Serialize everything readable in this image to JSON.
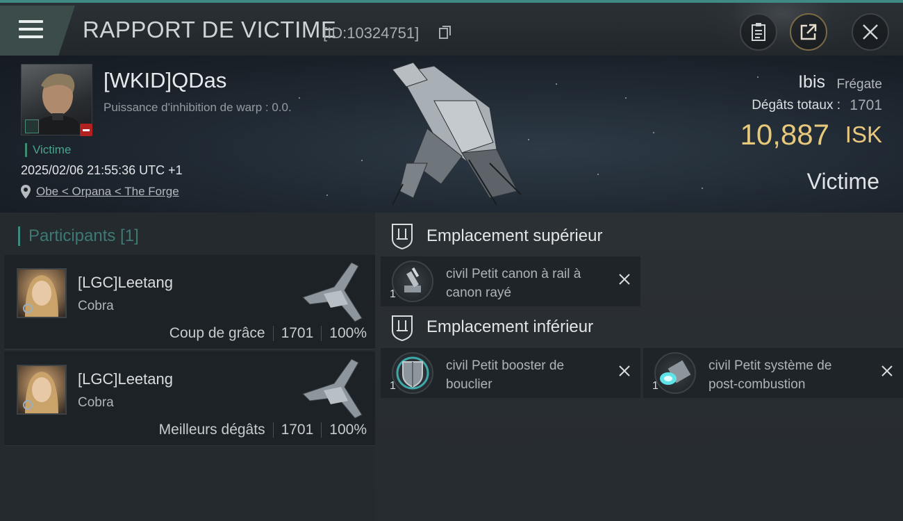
{
  "header": {
    "title": "RAPPORT DE VICTIME",
    "report_id": "[ID:10324751]"
  },
  "victim": {
    "name": "[WKID]QDas",
    "warp_text": "Puissance d'inhibition de warp : 0.0.",
    "tag": "Victime",
    "datetime": "2025/02/06 21:55:36 UTC +1",
    "location": "Obe < Orpana < The Forge",
    "ship_name": "Ibis",
    "ship_class": "Frégate",
    "damage_label": "Dégâts totaux :",
    "damage_value": "1701",
    "isk_value": "10,887",
    "isk_unit": "ISK",
    "role_label": "Victime"
  },
  "participants": {
    "header": "Participants [1]",
    "rows": [
      {
        "name": "[LGC]Leetang",
        "ship": "Cobra",
        "label": "Coup de grâce",
        "damage": "1701",
        "percent": "100%"
      },
      {
        "name": "[LGC]Leetang",
        "ship": "Cobra",
        "label": "Meilleurs dégâts",
        "damage": "1701",
        "percent": "100%"
      }
    ]
  },
  "slots": {
    "upper_title": "Emplacement supérieur",
    "lower_title": "Emplacement inférieur",
    "upper_modules": [
      {
        "name": "civil Petit canon à rail à canon rayé",
        "qty": "1",
        "icon": "railgun-icon"
      }
    ],
    "lower_modules": [
      {
        "name": "civil Petit booster de bouclier",
        "qty": "1",
        "icon": "shield-booster-icon"
      },
      {
        "name": "civil Petit système de post-combustion",
        "qty": "1",
        "icon": "afterburner-icon"
      }
    ]
  },
  "colors": {
    "accent": "#3f8a84",
    "isk": "#e8c97c",
    "victim_tag": "#4da48c",
    "danger": "#b32020"
  }
}
